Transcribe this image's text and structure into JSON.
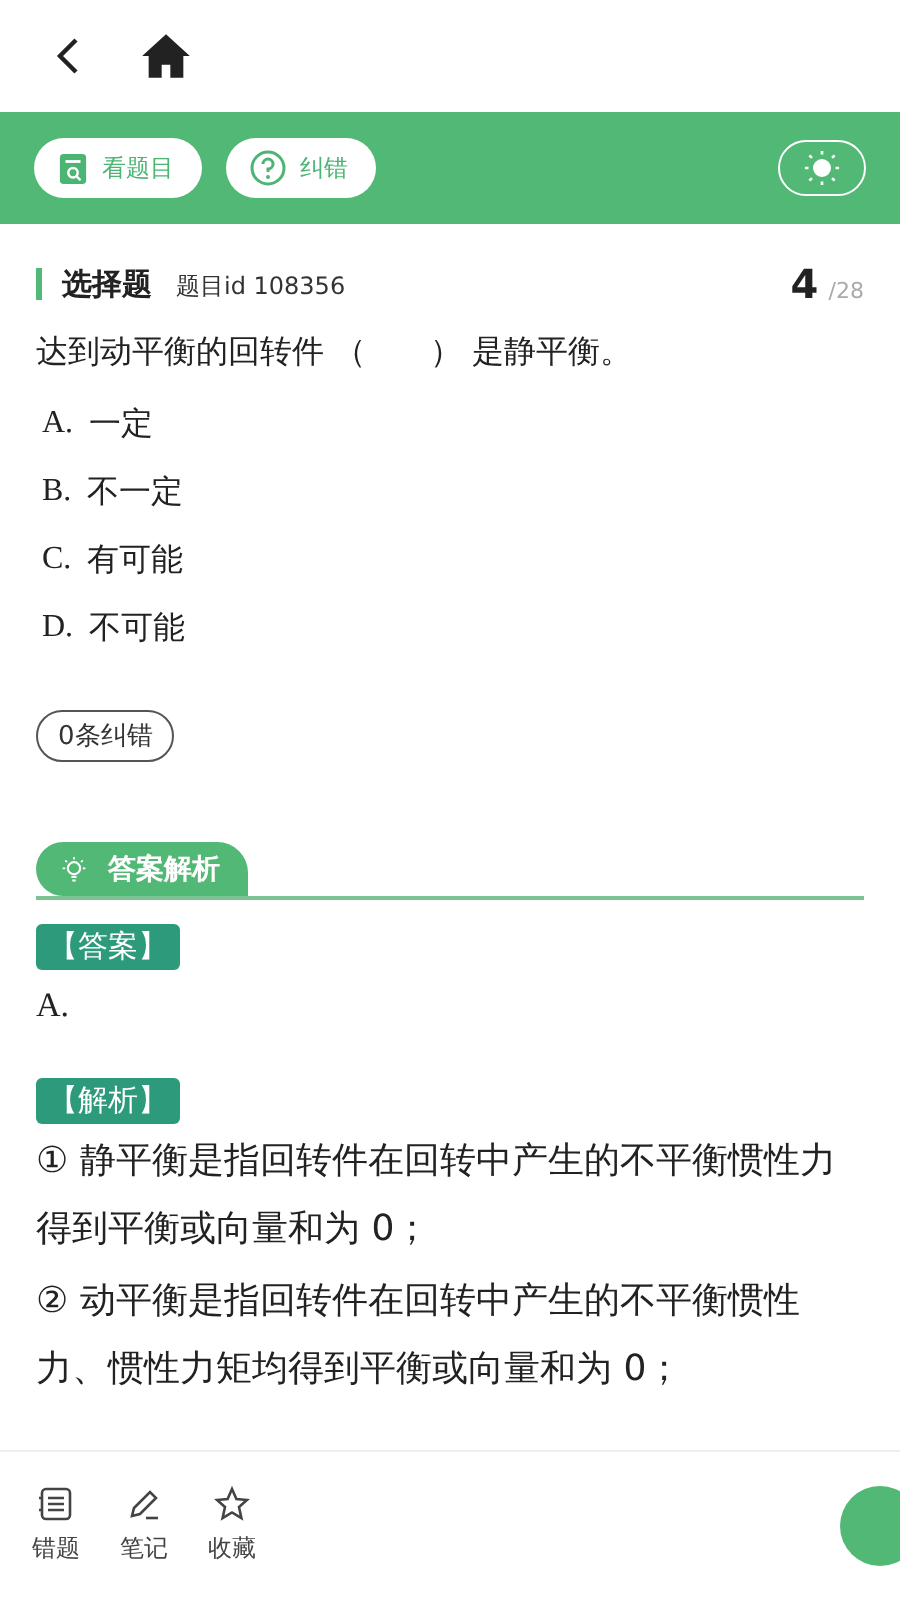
{
  "toolbar": {
    "buttons": [
      {
        "label": "看题目",
        "kind": "doc"
      },
      {
        "label": "纠错",
        "kind": "help"
      }
    ],
    "theme_toggle": {
      "on": false
    }
  },
  "question": {
    "type": "选择题",
    "id": "题目id 108356",
    "number": "4",
    "total": "/28",
    "text": "达到动平衡的回转件 （　　） 是静平衡。",
    "options": [
      {
        "letter": "A.",
        "text": "一定"
      },
      {
        "letter": "B.",
        "text": "不一定"
      },
      {
        "letter": "C.",
        "text": "有可能"
      },
      {
        "letter": "D.",
        "text": "不可能"
      }
    ],
    "corrections": "0条纠错"
  },
  "analysis": {
    "title": "答案解析",
    "answer_label": "【答案】",
    "answer": "A.",
    "explanation_label": "【解析】",
    "paragraphs": [
      "① 静平衡是指回转件在回转中产生的不平衡惯性力得到平衡或向量和为 0；",
      "② 动平衡是指回转件在回转中产生的不平衡惯性力、惯性力矩均得到平衡或向量和为 0；"
    ]
  },
  "bottom_bar": {
    "items": [
      {
        "label": "错题",
        "kind": "list"
      },
      {
        "label": "笔记",
        "kind": "pen"
      },
      {
        "label": "收藏",
        "kind": "star"
      }
    ]
  }
}
